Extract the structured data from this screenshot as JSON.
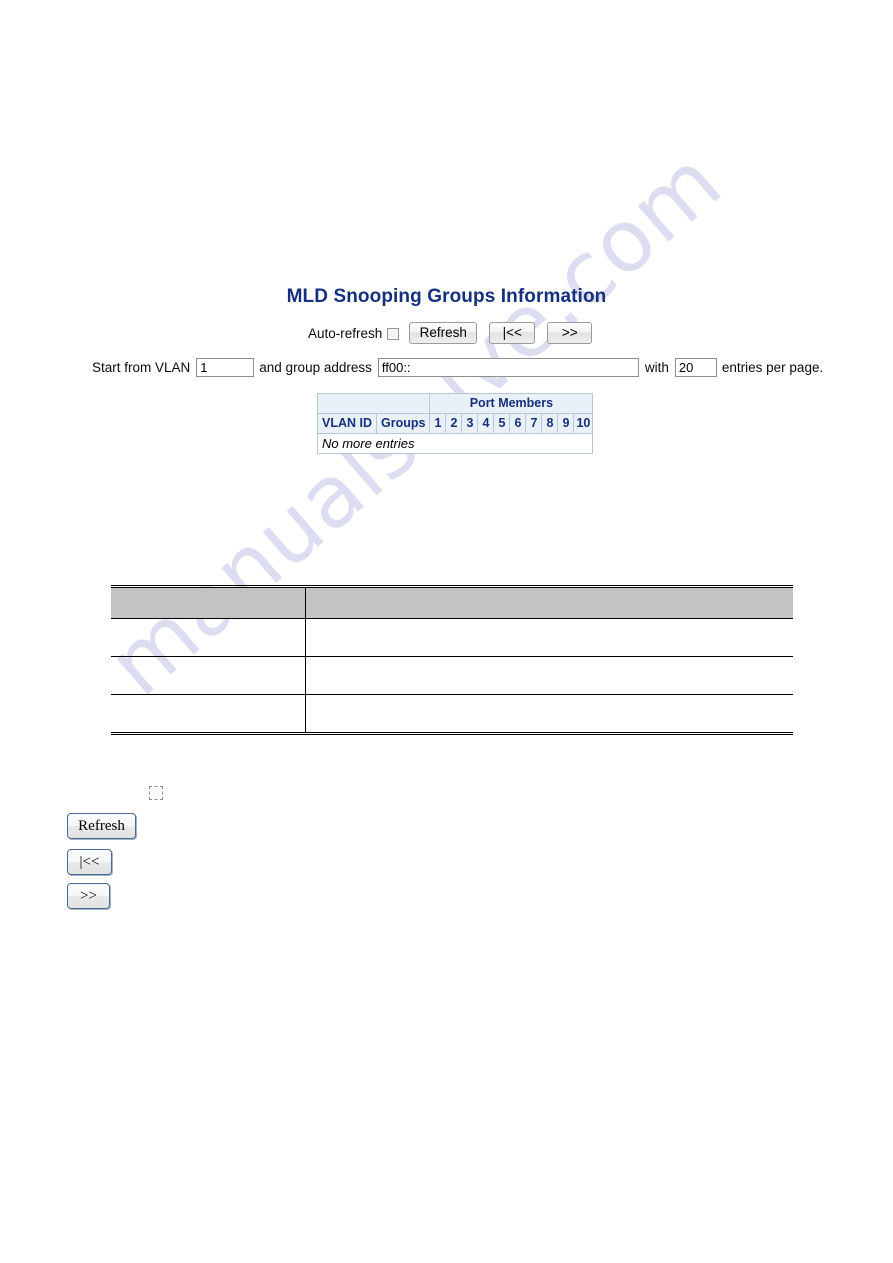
{
  "page": {
    "title": "MLD Snooping Groups Information",
    "title_color": "#15307d",
    "watermark_text": "manualshive.com"
  },
  "toolbar": {
    "auto_refresh_label": "Auto-refresh",
    "auto_refresh_checked": false,
    "refresh_label": "Refresh",
    "first_page_label": "|<<",
    "next_page_label": ">>"
  },
  "filter": {
    "start_label": "Start from VLAN",
    "vlan_value": "1",
    "vlan_placeholder": "",
    "address_label": "and group address",
    "address_value": "ff00::",
    "address_placeholder": "",
    "with_label": "with",
    "entries_value": "20",
    "entries_placeholder": "",
    "entries_suffix": "entries per page."
  },
  "groups_table": {
    "group_header_blank": "",
    "port_members_header": "Port Members",
    "col_vlan_id": "VLAN ID",
    "col_groups": "Groups",
    "ports": [
      "1",
      "2",
      "3",
      "4",
      "5",
      "6",
      "7",
      "8",
      "9",
      "10"
    ],
    "empty_message": "No more entries",
    "header_bg": "#e9f0f7",
    "header_text_color": "#15307d",
    "border_color": "#4b6f8e"
  },
  "description_table": {
    "header_bg": "#c3c3c3",
    "columns": [
      "",
      ""
    ],
    "rows": [
      [
        "",
        ""
      ],
      [
        "",
        ""
      ],
      [
        "",
        ""
      ]
    ]
  },
  "legend": {
    "checkbox_caption": "",
    "refresh_label": "Refresh",
    "first_page_label": "|<<",
    "next_page_label": ">>"
  }
}
